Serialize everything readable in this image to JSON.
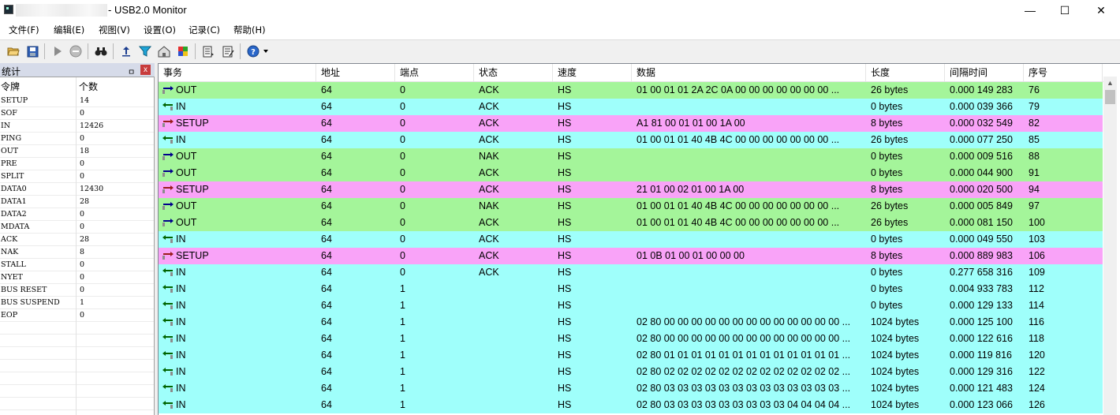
{
  "window": {
    "title": "- USB2.0 Monitor",
    "minimize": "—",
    "maximize": "☐",
    "close": "✕"
  },
  "menu": [
    "文件(F)",
    "编辑(E)",
    "视图(V)",
    "设置(O)",
    "记录(C)",
    "帮助(H)"
  ],
  "toolbar": [
    "open-folder-icon",
    "save-icon",
    "play-icon",
    "stop-icon",
    "binoculars-icon",
    "upload-icon",
    "filter-icon",
    "settings-icon",
    "color-icon",
    "export-icon",
    "notes-icon",
    "help-icon",
    "dropdown-icon"
  ],
  "stats": {
    "title": "统计",
    "pin": "ㅁ",
    "close": "x",
    "col_token": "令牌",
    "col_count": "个数",
    "rows": [
      {
        "token": "SETUP",
        "count": "14"
      },
      {
        "token": "SOF",
        "count": "0"
      },
      {
        "token": "IN",
        "count": "12426"
      },
      {
        "token": "PING",
        "count": "0"
      },
      {
        "token": "OUT",
        "count": "18"
      },
      {
        "token": "PRE",
        "count": "0"
      },
      {
        "token": "SPLIT",
        "count": "0"
      },
      {
        "token": "DATA0",
        "count": "12430"
      },
      {
        "token": "DATA1",
        "count": "28"
      },
      {
        "token": "DATA2",
        "count": "0"
      },
      {
        "token": "MDATA",
        "count": "0"
      },
      {
        "token": "ACK",
        "count": "28"
      },
      {
        "token": "NAK",
        "count": "8"
      },
      {
        "token": "STALL",
        "count": "0"
      },
      {
        "token": "NYET",
        "count": "0"
      },
      {
        "token": "BUS RESET",
        "count": "0"
      },
      {
        "token": "BUS SUSPEND",
        "count": "1"
      },
      {
        "token": "EOP",
        "count": "0"
      }
    ]
  },
  "table": {
    "columns": [
      "事务",
      "地址",
      "端点",
      "状态",
      "速度",
      "数据",
      "长度",
      "间隔时间",
      "序号"
    ],
    "colors": {
      "OUT": "#a4f59a",
      "IN": "#9ffffb",
      "SETUP": "#f9a3f8",
      "arrow_out": "#00008b",
      "arrow_in": "#006400",
      "arrow_setup": "#9b1b1b"
    },
    "rows": [
      {
        "type": "OUT",
        "event": "OUT",
        "addr": "64",
        "ep": "0",
        "status": "ACK",
        "speed": "HS",
        "data": "01 00 01 01 2A 2C 0A 00 00 00 00 00 00 00 ...",
        "len": "26 bytes",
        "interval": "0.000 149 283",
        "seq": "76"
      },
      {
        "type": "IN",
        "event": "IN",
        "addr": "64",
        "ep": "0",
        "status": "ACK",
        "speed": "HS",
        "data": "",
        "len": "0 bytes",
        "interval": "0.000 039 366",
        "seq": "79"
      },
      {
        "type": "SETUP",
        "event": "SETUP",
        "addr": "64",
        "ep": "0",
        "status": "ACK",
        "speed": "HS",
        "data": "A1 81 00 01 01 00 1A 00",
        "len": "8 bytes",
        "interval": "0.000 032 549",
        "seq": "82"
      },
      {
        "type": "IN",
        "event": "IN",
        "addr": "64",
        "ep": "0",
        "status": "ACK",
        "speed": "HS",
        "data": "01 00 01 01 40 4B 4C 00 00 00 00 00 00 00 ...",
        "len": "26 bytes",
        "interval": "0.000 077 250",
        "seq": "85"
      },
      {
        "type": "OUT",
        "event": "OUT",
        "addr": "64",
        "ep": "0",
        "status": "NAK",
        "speed": "HS",
        "data": "",
        "len": "0 bytes",
        "interval": "0.000 009 516",
        "seq": "88"
      },
      {
        "type": "OUT",
        "event": "OUT",
        "addr": "64",
        "ep": "0",
        "status": "ACK",
        "speed": "HS",
        "data": "",
        "len": "0 bytes",
        "interval": "0.000 044 900",
        "seq": "91"
      },
      {
        "type": "SETUP",
        "event": "SETUP",
        "addr": "64",
        "ep": "0",
        "status": "ACK",
        "speed": "HS",
        "data": "21 01 00 02 01 00 1A 00",
        "len": "8 bytes",
        "interval": "0.000 020 500",
        "seq": "94"
      },
      {
        "type": "OUT",
        "event": "OUT",
        "addr": "64",
        "ep": "0",
        "status": "NAK",
        "speed": "HS",
        "data": "01 00 01 01 40 4B 4C 00 00 00 00 00 00 00 ...",
        "len": "26 bytes",
        "interval": "0.000 005 849",
        "seq": "97"
      },
      {
        "type": "OUT",
        "event": "OUT",
        "addr": "64",
        "ep": "0",
        "status": "ACK",
        "speed": "HS",
        "data": "01 00 01 01 40 4B 4C 00 00 00 00 00 00 00 ...",
        "len": "26 bytes",
        "interval": "0.000 081 150",
        "seq": "100"
      },
      {
        "type": "IN",
        "event": "IN",
        "addr": "64",
        "ep": "0",
        "status": "ACK",
        "speed": "HS",
        "data": "",
        "len": "0 bytes",
        "interval": "0.000 049 550",
        "seq": "103"
      },
      {
        "type": "SETUP",
        "event": "SETUP",
        "addr": "64",
        "ep": "0",
        "status": "ACK",
        "speed": "HS",
        "data": "01 0B 01 00 01 00 00 00",
        "len": "8 bytes",
        "interval": "0.000 889 983",
        "seq": "106"
      },
      {
        "type": "IN",
        "event": "IN",
        "addr": "64",
        "ep": "0",
        "status": "ACK",
        "speed": "HS",
        "data": "",
        "len": "0 bytes",
        "interval": "0.277 658 316",
        "seq": "109"
      },
      {
        "type": "IN",
        "event": "IN",
        "addr": "64",
        "ep": "1",
        "status": "",
        "speed": "HS",
        "data": "",
        "len": "0 bytes",
        "interval": "0.004 933 783",
        "seq": "112"
      },
      {
        "type": "IN",
        "event": "IN",
        "addr": "64",
        "ep": "1",
        "status": "",
        "speed": "HS",
        "data": "",
        "len": "0 bytes",
        "interval": "0.000 129 133",
        "seq": "114"
      },
      {
        "type": "IN",
        "event": "IN",
        "addr": "64",
        "ep": "1",
        "status": "",
        "speed": "HS",
        "data": "02 80 00 00 00 00 00 00 00 00 00 00 00 00 00 ...",
        "len": "1024 bytes",
        "interval": "0.000 125 100",
        "seq": "116"
      },
      {
        "type": "IN",
        "event": "IN",
        "addr": "64",
        "ep": "1",
        "status": "",
        "speed": "HS",
        "data": "02 80 00 00 00 00 00 00 00 00 00 00 00 00 00 ...",
        "len": "1024 bytes",
        "interval": "0.000 122 616",
        "seq": "118"
      },
      {
        "type": "IN",
        "event": "IN",
        "addr": "64",
        "ep": "1",
        "status": "",
        "speed": "HS",
        "data": "02 80 01 01 01 01 01 01 01 01 01 01 01 01 01 ...",
        "len": "1024 bytes",
        "interval": "0.000 119 816",
        "seq": "120"
      },
      {
        "type": "IN",
        "event": "IN",
        "addr": "64",
        "ep": "1",
        "status": "",
        "speed": "HS",
        "data": "02 80 02 02 02 02 02 02 02 02 02 02 02 02 02 ...",
        "len": "1024 bytes",
        "interval": "0.000 129 316",
        "seq": "122"
      },
      {
        "type": "IN",
        "event": "IN",
        "addr": "64",
        "ep": "1",
        "status": "",
        "speed": "HS",
        "data": "02 80 03 03 03 03 03 03 03 03 03 03 03 03 03 ...",
        "len": "1024 bytes",
        "interval": "0.000 121 483",
        "seq": "124"
      },
      {
        "type": "IN",
        "event": "IN",
        "addr": "64",
        "ep": "1",
        "status": "",
        "speed": "HS",
        "data": "02 80 03 03 03 03 03 03 03 03 03 04 04 04 04 ...",
        "len": "1024 bytes",
        "interval": "0.000 123 066",
        "seq": "126"
      }
    ]
  }
}
